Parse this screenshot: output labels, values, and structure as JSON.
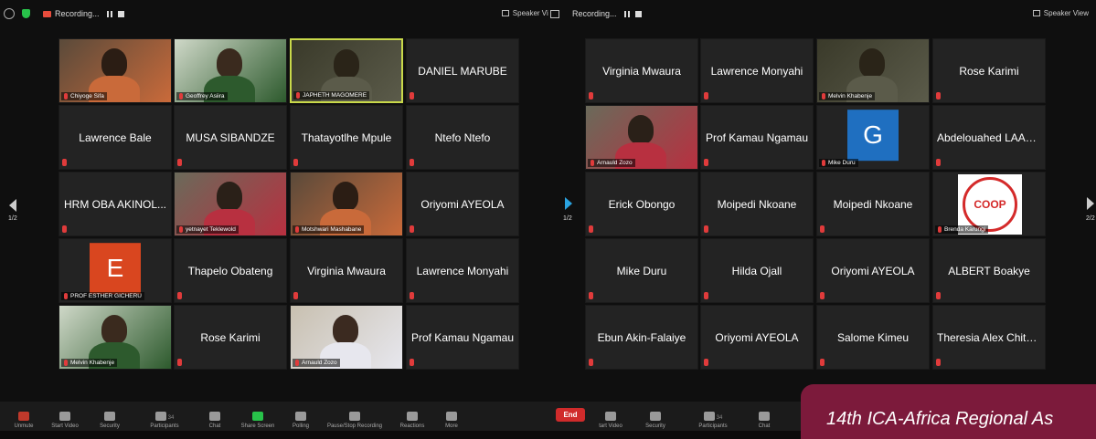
{
  "left_meeting": {
    "recording_label": "Recording...",
    "view_label": "Speaker View",
    "page_indicator": "1/2",
    "tiles": [
      {
        "name": "Chiyoge Sifa",
        "type": "video"
      },
      {
        "name": "Geoffrey Asiira",
        "type": "video"
      },
      {
        "name": "JAPHETH MAGOMERE",
        "type": "video",
        "active": true
      },
      {
        "name": "DANIEL MARUBE",
        "type": "name"
      },
      {
        "name": "Lawrence Bale",
        "type": "name"
      },
      {
        "name": "MUSA SIBANDZE",
        "type": "name"
      },
      {
        "name": "Thatayotlhe Mpule",
        "type": "name"
      },
      {
        "name": "Ntefo Ntefo",
        "type": "name"
      },
      {
        "name": "HRM OBA AKINOL...",
        "type": "name"
      },
      {
        "name": "yetnayet Teklewold",
        "type": "video"
      },
      {
        "name": "Motshwari Mashabane",
        "type": "video"
      },
      {
        "name": "Oriyomi AYEOLA",
        "type": "name"
      },
      {
        "name": "PROF ESTHER GICHERU",
        "type": "avatar",
        "initial": "E",
        "avatar_color": "#d9461f"
      },
      {
        "name": "Thapelo Obateng",
        "type": "name"
      },
      {
        "name": "Virginia Mwaura",
        "type": "name"
      },
      {
        "name": "Lawrence Monyahi",
        "type": "name"
      },
      {
        "name": "Melvin Khabenje",
        "type": "video"
      },
      {
        "name": "Rose Karimi",
        "type": "name"
      },
      {
        "name": "Arnauld Zozo",
        "type": "video"
      },
      {
        "name": "Prof Kamau Ngamau",
        "type": "name"
      }
    ],
    "toolbar": [
      {
        "label": "Unmute",
        "icon": "mic-muted-icon"
      },
      {
        "label": "Start Video",
        "icon": "video-off-icon"
      },
      {
        "label": "Security",
        "icon": "shield-icon"
      },
      {
        "label": "Participants",
        "icon": "participants-icon",
        "count": "34"
      },
      {
        "label": "Chat",
        "icon": "chat-icon"
      },
      {
        "label": "Share Screen",
        "icon": "share-screen-icon"
      },
      {
        "label": "Polling",
        "icon": "polling-icon"
      },
      {
        "label": "Pause/Stop Recording",
        "icon": "record-icon"
      },
      {
        "label": "Reactions",
        "icon": "reactions-icon"
      },
      {
        "label": "More",
        "icon": "more-icon"
      }
    ]
  },
  "right_meeting": {
    "recording_label": "Recording...",
    "view_label": "Speaker View",
    "page_indicator": "1/2",
    "page_indicator_right": "2/2",
    "tiles": [
      {
        "name": "Virginia Mwaura",
        "type": "name"
      },
      {
        "name": "Lawrence Monyahi",
        "type": "name"
      },
      {
        "name": "Melvin Khabenje",
        "type": "video"
      },
      {
        "name": "Rose Karimi",
        "type": "name"
      },
      {
        "name": "Arnauld Zozo",
        "type": "video"
      },
      {
        "name": "Prof Kamau Ngamau",
        "type": "name"
      },
      {
        "name": "Mike Duru",
        "type": "avatar",
        "initial": "G",
        "avatar_color": "#1f6fc0"
      },
      {
        "name": "Abdelouahed LAABID",
        "type": "name"
      },
      {
        "name": "Erick Obongo",
        "type": "name"
      },
      {
        "name": "Moipedi Nkoane",
        "type": "name"
      },
      {
        "name": "Moipedi Nkoane",
        "type": "name"
      },
      {
        "name": "Brenda Karungi",
        "type": "logo",
        "logo_text": "COOP"
      },
      {
        "name": "Mike Duru",
        "type": "name"
      },
      {
        "name": "Hilda Ojall",
        "type": "name"
      },
      {
        "name": "Oriyomi AYEOLA",
        "type": "name"
      },
      {
        "name": "ALBERT Boakye",
        "type": "name"
      },
      {
        "name": "Ebun Akin-Falaiye",
        "type": "name"
      },
      {
        "name": "Oriyomi AYEOLA",
        "type": "name"
      },
      {
        "name": "Salome Kimeu",
        "type": "name"
      },
      {
        "name": "Theresia Alex Chitu...",
        "type": "name"
      }
    ],
    "toolbar": [
      {
        "label": "End",
        "icon": "end-icon"
      },
      {
        "label": "tart Video",
        "icon": "video-off-icon"
      },
      {
        "label": "Security",
        "icon": "shield-icon"
      },
      {
        "label": "Participants",
        "icon": "participants-icon",
        "count": "34"
      },
      {
        "label": "Chat",
        "icon": "chat-icon"
      }
    ]
  },
  "banner": {
    "text": "14th ICA-Africa Regional As"
  },
  "colors": {
    "accent_active": "#c9d94a",
    "share": "#28c24a",
    "end": "#d02b2b",
    "banner": "#7c1a3b"
  }
}
